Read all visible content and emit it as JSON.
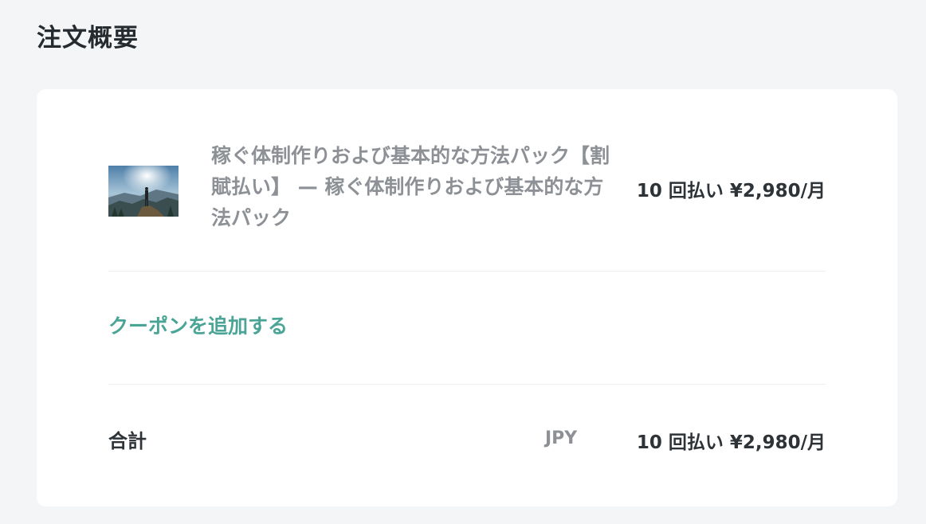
{
  "summary": {
    "title": "注文概要"
  },
  "item": {
    "name": "稼ぐ体制作りおよび基本的な方法パック【割賦払い】 — 稼ぐ体制作りおよび基本的な方法パック",
    "price": "10 回払い ¥2,980/月",
    "thumbnail": "hiker-on-mountain-image"
  },
  "coupon": {
    "label": "クーポンを追加する"
  },
  "total": {
    "label": "合計",
    "currency": "JPY",
    "amount": "10 回払い ¥2,980/月"
  },
  "colors": {
    "background": "#f4f5f7",
    "card": "#ffffff",
    "accent": "#4aa597",
    "text": "#2e3338",
    "muted": "#8d9196"
  }
}
